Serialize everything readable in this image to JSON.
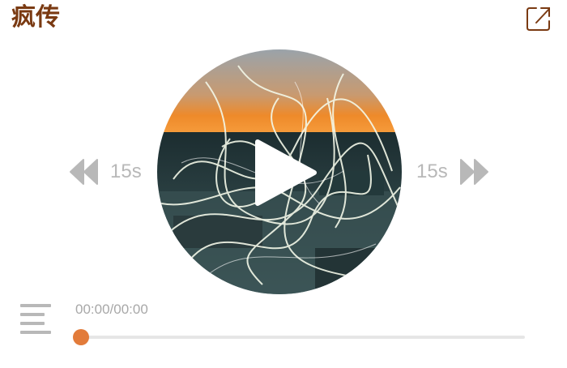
{
  "header": {
    "title": "疯传",
    "share_icon": "external-link-icon"
  },
  "player": {
    "skip_back_label": "15s",
    "skip_forward_label": "15s",
    "time_display": "00:00/00:00",
    "progress": 0,
    "accent_color": "#e27b3a",
    "title_color": "#7a3a12",
    "icons": {
      "play": "play-icon",
      "rewind": "rewind-icon",
      "fast_forward": "fast-forward-icon",
      "playlist": "playlist-icon"
    }
  }
}
